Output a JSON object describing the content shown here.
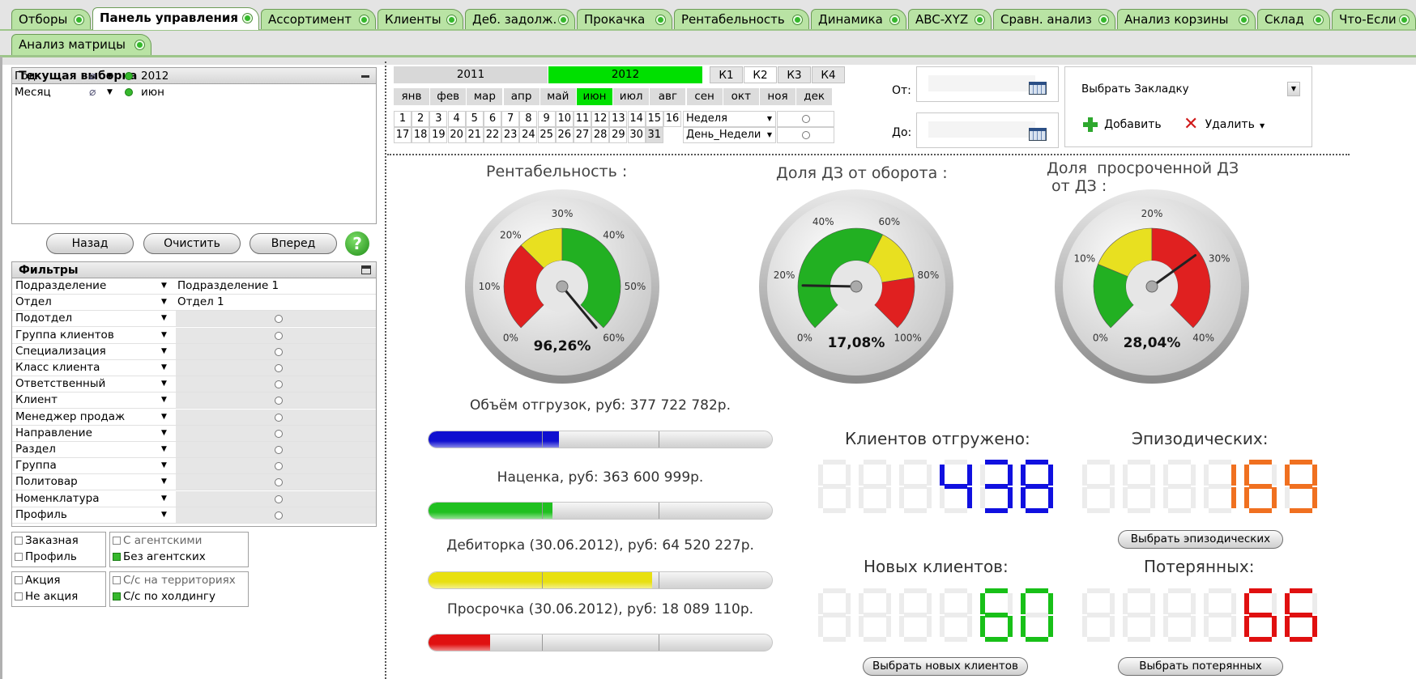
{
  "tabs_row1": [
    {
      "label": "Отборы",
      "active": false
    },
    {
      "label": "Панель управления",
      "active": true
    },
    {
      "label": "Ассортимент",
      "active": false
    },
    {
      "label": "Клиенты",
      "active": false
    },
    {
      "label": "Деб. задолж.",
      "active": false
    },
    {
      "label": "Прокачка",
      "active": false
    },
    {
      "label": "Рентабельность",
      "active": false
    },
    {
      "label": "Динамика",
      "active": false
    },
    {
      "label": "ABC-XYZ",
      "active": false
    },
    {
      "label": "Сравн. анализ",
      "active": false
    },
    {
      "label": "Анализ корзины",
      "active": false
    },
    {
      "label": "Склад",
      "active": false
    },
    {
      "label": "Что-Если",
      "active": false
    }
  ],
  "tabs_row2": [
    {
      "label": "Анализ матрицы",
      "active": false
    }
  ],
  "current_selection": {
    "title": "Текущая выборка",
    "rows": [
      {
        "field": "Год",
        "value": "2012"
      },
      {
        "field": "Месяц",
        "value": "июн"
      }
    ]
  },
  "nav_buttons": {
    "back": "Назад",
    "clear": "Очистить",
    "forward": "Вперед",
    "help": "?"
  },
  "filters": {
    "title": "Фильтры",
    "rows": [
      {
        "label": "Подразделение",
        "value": "Подразделение 1"
      },
      {
        "label": "Отдел",
        "value": "Отдел 1"
      },
      {
        "label": "Подотдел",
        "value": ""
      },
      {
        "label": "Группа клиентов",
        "value": ""
      },
      {
        "label": "Специализация",
        "value": ""
      },
      {
        "label": "Класс клиента",
        "value": ""
      },
      {
        "label": "Ответственный",
        "value": ""
      },
      {
        "label": "Клиент",
        "value": ""
      },
      {
        "label": "Менеджер продаж",
        "value": ""
      },
      {
        "label": "Направление",
        "value": ""
      },
      {
        "label": "Раздел",
        "value": ""
      },
      {
        "label": "Группа",
        "value": ""
      },
      {
        "label": "Политовар",
        "value": ""
      },
      {
        "label": "Номенклатура",
        "value": ""
      },
      {
        "label": "Профиль",
        "value": ""
      }
    ]
  },
  "checkboxes": {
    "box1": [
      {
        "label": "Заказная",
        "checked": false
      },
      {
        "label": "Профиль",
        "checked": false
      }
    ],
    "box2": [
      {
        "label": "С агентскими",
        "checked": false,
        "dim": true
      },
      {
        "label": "Без агентских",
        "checked": true,
        "dim": false
      }
    ],
    "box3": [
      {
        "label": "Акция",
        "checked": false
      },
      {
        "label": "Не акция",
        "checked": false
      }
    ],
    "box4": [
      {
        "label": "С/с на территориях",
        "checked": false,
        "dim": true
      },
      {
        "label": "С/с по холдингу",
        "checked": true,
        "dim": false
      }
    ]
  },
  "calendar": {
    "years": [
      {
        "label": "2011",
        "selected": false
      },
      {
        "label": "2012",
        "selected": true
      }
    ],
    "quarters": [
      "К1",
      "К2",
      "К3",
      "К4"
    ],
    "months": [
      {
        "label": "янв"
      },
      {
        "label": "фев"
      },
      {
        "label": "мар"
      },
      {
        "label": "апр"
      },
      {
        "label": "май"
      },
      {
        "label": "июн",
        "selected": true
      },
      {
        "label": "июл"
      },
      {
        "label": "авг"
      },
      {
        "label": "сен"
      },
      {
        "label": "окт"
      },
      {
        "label": "ноя"
      },
      {
        "label": "дек"
      }
    ],
    "days_row1": [
      "1",
      "2",
      "3",
      "4",
      "5",
      "6",
      "7",
      "8",
      "9",
      "10",
      "11",
      "12",
      "13",
      "14",
      "15",
      "16"
    ],
    "days_row2": [
      "17",
      "18",
      "19",
      "20",
      "21",
      "22",
      "23",
      "24",
      "25",
      "26",
      "27",
      "28",
      "29",
      "30",
      "31"
    ],
    "week_label": "Неделя",
    "weekday_label": "День_Недели"
  },
  "date_range": {
    "from_label": "От:",
    "to_label": "До:",
    "from_value": "",
    "to_value": ""
  },
  "bookmark": {
    "select_label": "Выбрать Закладку",
    "add": "Добавить",
    "delete": "Удалить"
  },
  "gauges": [
    {
      "title": "Рентабельность :",
      "value_text": "96,26%",
      "value": 0.9626,
      "min": 0,
      "max": 0.6,
      "ticks": [
        "0%",
        "10%",
        "20%",
        "30%",
        "40%",
        "50%",
        "60%"
      ],
      "zones": [
        {
          "from": 0,
          "to": 0.2,
          "color": "#e02020"
        },
        {
          "from": 0.2,
          "to": 0.3,
          "color": "#e8e020"
        },
        {
          "from": 0.3,
          "to": 0.6,
          "color": "#22b022"
        }
      ]
    },
    {
      "title": "Доля ДЗ от оборота :",
      "value_text": "17,08%",
      "value": 0.1708,
      "min": 0,
      "max": 1,
      "ticks": [
        "0%",
        "20%",
        "40%",
        "60%",
        "80%",
        "100%"
      ],
      "zones": [
        {
          "from": 0,
          "to": 0.6,
          "color": "#22b022"
        },
        {
          "from": 0.6,
          "to": 0.8,
          "color": "#e8e020"
        },
        {
          "from": 0.8,
          "to": 1,
          "color": "#e02020"
        }
      ]
    },
    {
      "title": "Доля  просроченной ДЗ\n от ДЗ :",
      "value_text": "28,04%",
      "value": 0.2804,
      "min": 0,
      "max": 0.4,
      "ticks": [
        "0%",
        "10%",
        "20%",
        "30%",
        "40%"
      ],
      "zones": [
        {
          "from": 0,
          "to": 0.1,
          "color": "#22b022"
        },
        {
          "from": 0.1,
          "to": 0.2,
          "color": "#e8e020"
        },
        {
          "from": 0.2,
          "to": 0.4,
          "color": "#e02020"
        }
      ]
    }
  ],
  "bars": [
    {
      "title": "Объём отгрузок, руб:  377 722 782р.",
      "fraction": 0.38,
      "color": "#1010d0"
    },
    {
      "title": "Наценка, руб:  363 600 999р.",
      "fraction": 0.36,
      "color": "#20c020"
    },
    {
      "title": "Дебиторка (30.06.2012), руб:  64 520 227р.",
      "fraction": 0.65,
      "color": "#e8e010"
    },
    {
      "title": "Просрочка (30.06.2012), руб:  18 089 110р.",
      "fraction": 0.18,
      "color": "#e01010"
    }
  ],
  "counters": [
    {
      "title": "Клиентов отгружено:",
      "value": "438",
      "color": "#1010e0",
      "button": ""
    },
    {
      "title": "Эпизодических:",
      "value": "169",
      "color": "#f07020",
      "button": "Выбрать эпизодических"
    },
    {
      "title": "Новых клиентов:",
      "value": "60",
      "color": "#18c018",
      "button": "Выбрать новых клиентов"
    },
    {
      "title": "Потерянных:",
      "value": "66",
      "color": "#e01010",
      "button": "Выбрать потерянных"
    }
  ],
  "colors": {
    "tab_green": "#b9e3a4",
    "selected_green": "#00e000",
    "status_dot": "#36b82d"
  }
}
